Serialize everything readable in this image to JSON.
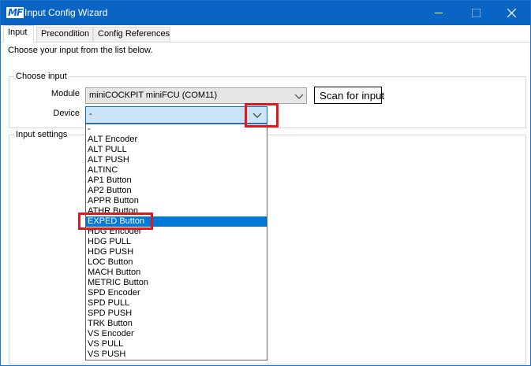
{
  "window": {
    "logo": "MF",
    "title": "Input Config Wizard"
  },
  "tabs": [
    {
      "label": "Input",
      "active": true
    },
    {
      "label": "Precondition",
      "active": false
    },
    {
      "label": "Config References",
      "active": false
    }
  ],
  "intro_text": "Choose your input from the list below.",
  "choose_input": {
    "legend": "Choose input",
    "module_label": "Module",
    "module_value": "miniCOCKPIT miniFCU (COM11)",
    "device_label": "Device",
    "device_value": "-",
    "scan_button": "Scan for input"
  },
  "input_settings": {
    "legend": "Input settings"
  },
  "device_options": [
    "-",
    "ALT Encoder",
    "ALT PULL",
    "ALT PUSH",
    "ALTINC",
    "AP1 Button",
    "AP2 Button",
    "APPR Button",
    "ATHR Button",
    "EXPED Button",
    "HDG Encoder",
    "HDG PULL",
    "HDG PUSH",
    "LOC Button",
    "MACH Button",
    "METRIC Button",
    "SPD Encoder",
    "SPD PULL",
    "SPD PUSH",
    "TRK Button",
    "VS Encoder",
    "VS PULL",
    "VS PUSH"
  ],
  "selected_option_index": 9,
  "colors": {
    "titlebar": "#0a64c4",
    "selection": "#0078d7",
    "highlight": "#e0181e"
  }
}
